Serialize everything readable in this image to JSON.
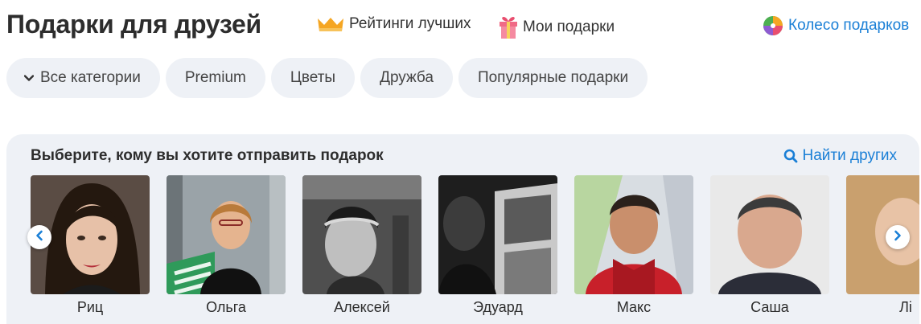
{
  "header": {
    "title": "Подарки для друзей",
    "ratings_label": "Рейтинги лучших",
    "my_gifts_label": "Мои подарки",
    "wheel_label": "Колесо подарков"
  },
  "categories": {
    "all_label": "Все категории",
    "items": [
      "Premium",
      "Цветы",
      "Дружба",
      "Популярные подарки"
    ]
  },
  "friends_panel": {
    "title": "Выберите, кому вы хотите отправить подарок",
    "find_label": "Найти других",
    "friends": [
      "Риц",
      "Ольга",
      "Алексей",
      "Эдуард",
      "Макс",
      "Саша",
      "Лі"
    ]
  },
  "colors": {
    "accent": "#1a7fd6",
    "pill_bg": "#eef1f6",
    "text": "#2d2d2d",
    "crown": "#f5a623",
    "gift": "#f06a86"
  }
}
